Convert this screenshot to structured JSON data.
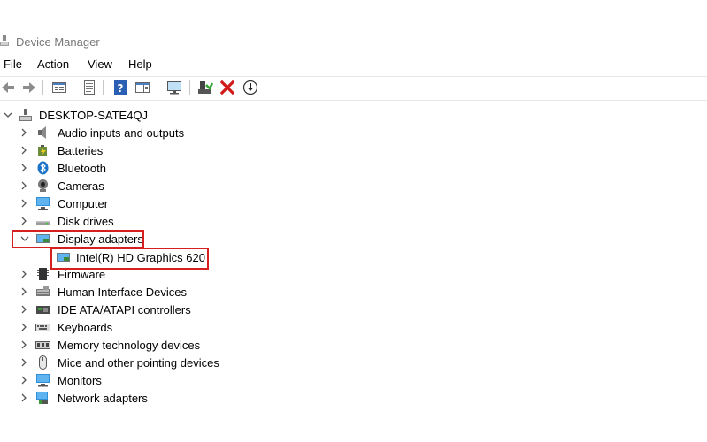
{
  "window": {
    "title": "Device Manager"
  },
  "menu": [
    "File",
    "Action",
    "View",
    "Help"
  ],
  "toolbar_icons": [
    "back-arrow-icon",
    "forward-arrow-icon",
    "properties-icon",
    "update-list-icon",
    "help-icon",
    "action-pane-icon",
    "monitor-icon",
    "add-driver-icon",
    "uninstall-x-icon",
    "download-icon"
  ],
  "tree": {
    "root": "DESKTOP-SATE4QJ",
    "categories": [
      {
        "label": "Audio inputs and outputs",
        "icon": "speaker-icon"
      },
      {
        "label": "Batteries",
        "icon": "battery-icon"
      },
      {
        "label": "Bluetooth",
        "icon": "bluetooth-icon"
      },
      {
        "label": "Cameras",
        "icon": "camera-icon"
      },
      {
        "label": "Computer",
        "icon": "computer-icon"
      },
      {
        "label": "Disk drives",
        "icon": "disk-drive-icon"
      },
      {
        "label": "Display adapters",
        "icon": "display-adapter-icon",
        "expanded": true,
        "children": [
          "Intel(R) HD Graphics 620"
        ]
      },
      {
        "label": "Firmware",
        "icon": "firmware-icon"
      },
      {
        "label": "Human Interface Devices",
        "icon": "hid-icon"
      },
      {
        "label": "IDE ATA/ATAPI controllers",
        "icon": "ide-controller-icon"
      },
      {
        "label": "Keyboards",
        "icon": "keyboard-icon"
      },
      {
        "label": "Memory technology devices",
        "icon": "memory-icon"
      },
      {
        "label": "Mice and other pointing devices",
        "icon": "mouse-icon"
      },
      {
        "label": "Monitors",
        "icon": "monitor-icon"
      },
      {
        "label": "Network adapters",
        "icon": "network-adapter-icon"
      }
    ]
  },
  "colors": {
    "highlight_box": "#d42020",
    "accent_blue": "#1a73c8"
  }
}
